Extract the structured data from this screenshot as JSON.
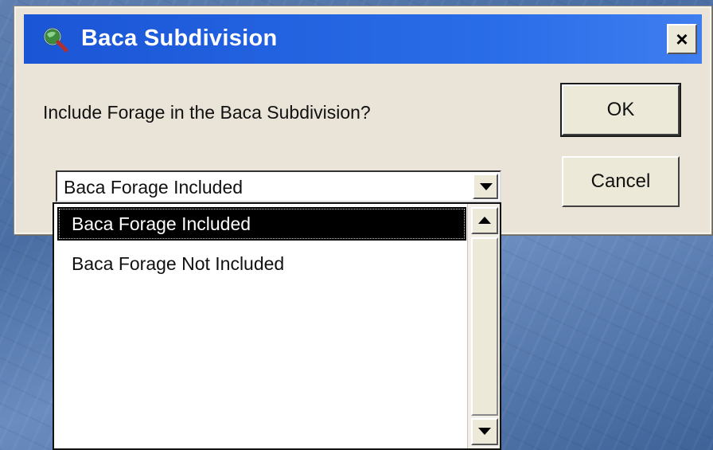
{
  "window": {
    "title": "Baca Subdivision",
    "icon": "globe-magnifier-icon",
    "close_label": "×"
  },
  "dialog": {
    "prompt": "Include Forage in the Baca Subdivision?",
    "ok_label": "OK",
    "cancel_label": "Cancel"
  },
  "combo": {
    "selected_value": "Baca Forage Included",
    "options": [
      "Baca Forage Included",
      "Baca Forage Not Included"
    ],
    "highlighted_index": 0
  },
  "colors": {
    "titlebar": "#2a6de8",
    "dialog_face": "#e9e4d7",
    "selection": "#000000"
  }
}
